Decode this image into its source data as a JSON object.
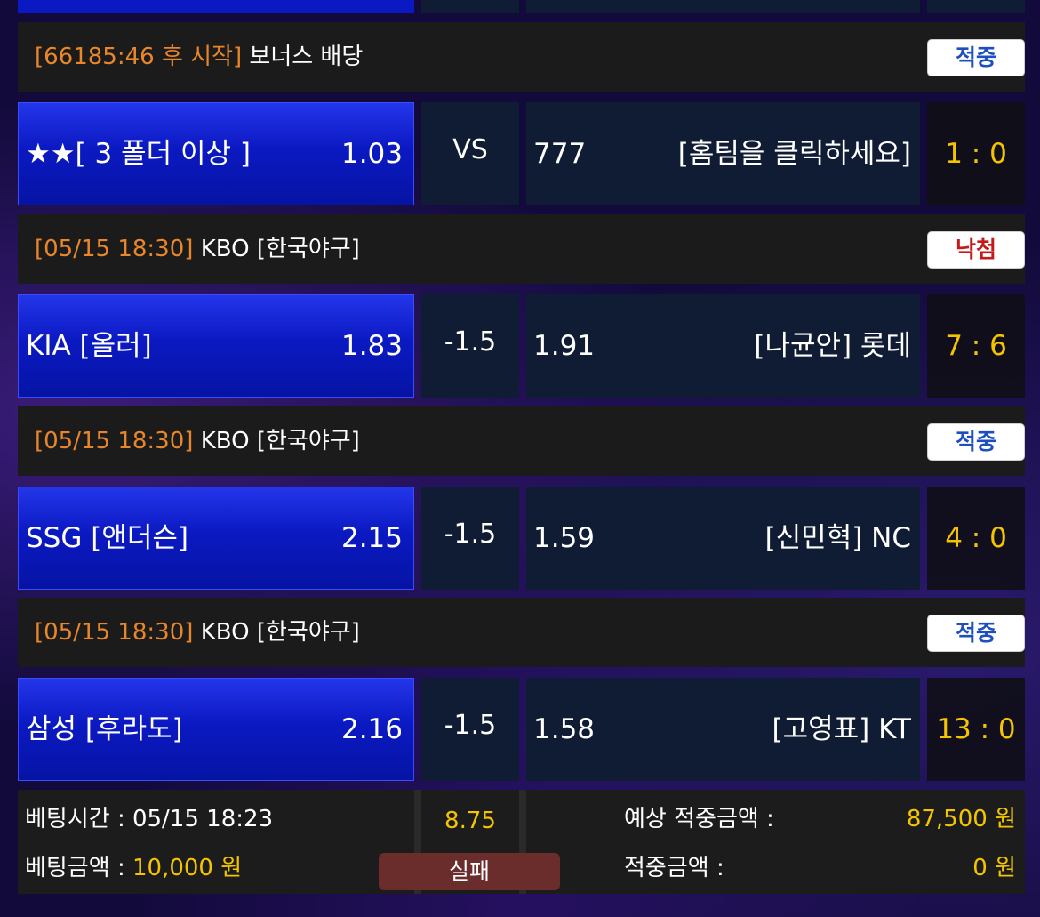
{
  "colors": {
    "time_text": "#e8862a",
    "score_text": "#f5c400",
    "hit_badge_text": "#1d4fbf",
    "miss_badge_text": "#c41a1a",
    "home_cell_blue": "#0b19c2",
    "result_fail_bg": "#6b2c2c"
  },
  "matches": [
    {
      "header_time": "[66185:46 후 시작]",
      "header_league": "보너스 배당",
      "status": "적중",
      "home_name": "★★[ 3 폴더 이상 ]",
      "home_odds": "1.03",
      "mid": "VS",
      "away_odds": "777",
      "away_name": "[홈팀을 클릭하세요]",
      "score": "1 : 0"
    },
    {
      "header_time": "[05/15 18:30]",
      "header_league": "KBO [한국야구]",
      "status": "낙첨",
      "home_name": "KIA [올러]",
      "home_odds": "1.83",
      "mid": "-1.5",
      "away_odds": "1.91",
      "away_name": "[나균안] 롯데",
      "score": "7 : 6"
    },
    {
      "header_time": "[05/15 18:30]",
      "header_league": "KBO [한국야구]",
      "status": "적중",
      "home_name": "SSG [앤더슨]",
      "home_odds": "2.15",
      "mid": "-1.5",
      "away_odds": "1.59",
      "away_name": "[신민혁] NC",
      "score": "4 : 0"
    },
    {
      "header_time": "[05/15 18:30]",
      "header_league": "KBO [한국야구]",
      "status": "적중",
      "home_name": "삼성 [후라도]",
      "home_odds": "2.16",
      "mid": "-1.5",
      "away_odds": "1.58",
      "away_name": "[고영표] KT",
      "score": "13 : 0"
    }
  ],
  "summary": {
    "bet_time_label": "베팅시간 : 05/15 18:23",
    "bet_amount_label": "베팅금액 : ",
    "bet_amount_value": "10,000 원",
    "total_odds": "8.75",
    "result": "실패",
    "expected_label": "예상 적중금액 :",
    "expected_value": "87,500 원",
    "won_label": "적중금액 :",
    "won_value": "0 원"
  }
}
